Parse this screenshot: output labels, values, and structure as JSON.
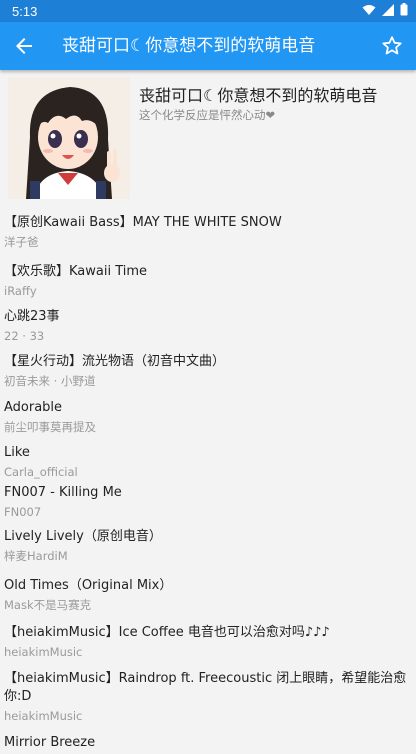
{
  "statusbar": {
    "time": "5:13"
  },
  "appbar": {
    "title": "丧甜可口☾你意想不到的软萌电音",
    "back_icon": "arrow-back-icon",
    "star_icon": "star-outline-icon"
  },
  "playlist": {
    "title": "丧甜可口☾你意想不到的软萌电音",
    "subtitle": "这个化学反应是怦然心动❤"
  },
  "songs": [
    {
      "title": "【原创Kawaii Bass】MAY THE WHITE SNOW",
      "artist": "洋子爸"
    },
    {
      "title": "【欢乐歌】Kawaii Time",
      "artist": "iRaffy"
    },
    {
      "title": "心跳23事",
      "artist": "22 · 33"
    },
    {
      "title": "【星火行动】流光物语（初音中文曲）",
      "artist": "初音未来 · 小野道"
    },
    {
      "title": "Adorable",
      "artist": "前尘叩事莫再提及"
    },
    {
      "title": "Like",
      "artist": "Carla_official"
    },
    {
      "title": "FN007 - Killing Me",
      "artist": "FN007"
    },
    {
      "title": " Lively Lively（原创电音）",
      "artist": "梓麦HardiM"
    },
    {
      "title": "Old Times（Original Mix）",
      "artist": "Mask不是马赛克"
    },
    {
      "title": "【heiakimMusic】Ice Coffee 电音也可以治愈对吗♪♪♪",
      "artist": "heiakimMusic"
    },
    {
      "title": "【heiakimMusic】Raindrop ft. Freecoustic 闭上眼睛，希望能治愈你:D",
      "artist": "heiakimMusic"
    },
    {
      "title": "Mirrior Breeze",
      "artist": ""
    }
  ],
  "colors": {
    "appbar": "#2196f3",
    "statusbar": "#1e7fd6",
    "background": "#f3f3f3"
  }
}
